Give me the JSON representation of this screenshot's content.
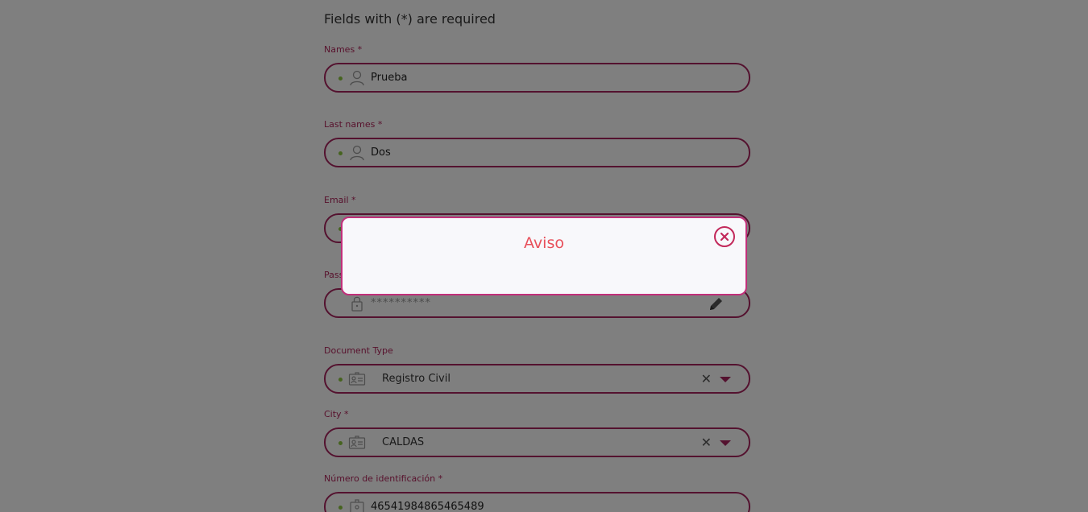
{
  "form": {
    "heading": "Fields with (*) are required",
    "names": {
      "label": "Names *",
      "value": "Prueba",
      "icon": "user-icon"
    },
    "last_names": {
      "label": "Last names *",
      "value": "Dos",
      "icon": "user-icon"
    },
    "email": {
      "label": "Email *",
      "value": "",
      "icon": "mail-icon"
    },
    "password": {
      "label": "Pass",
      "value": "**********",
      "icon": "lock-icon",
      "action_icon": "pencil-icon"
    },
    "document_type": {
      "label": "Document Type",
      "value": "Registro Civil",
      "icon": "id-card-icon"
    },
    "city": {
      "label": "City *",
      "value": "CALDAS",
      "icon": "id-card-icon"
    },
    "id_number": {
      "label": "Número de identificación *",
      "value": "46541984865465489",
      "icon": "id-badge-icon"
    }
  },
  "modal": {
    "title": "Aviso",
    "close_icon": "close-icon"
  },
  "colors": {
    "accent": "#a8245e",
    "label": "#b0245a",
    "dot": "#8cc63f",
    "modal_title": "#e8505b"
  }
}
